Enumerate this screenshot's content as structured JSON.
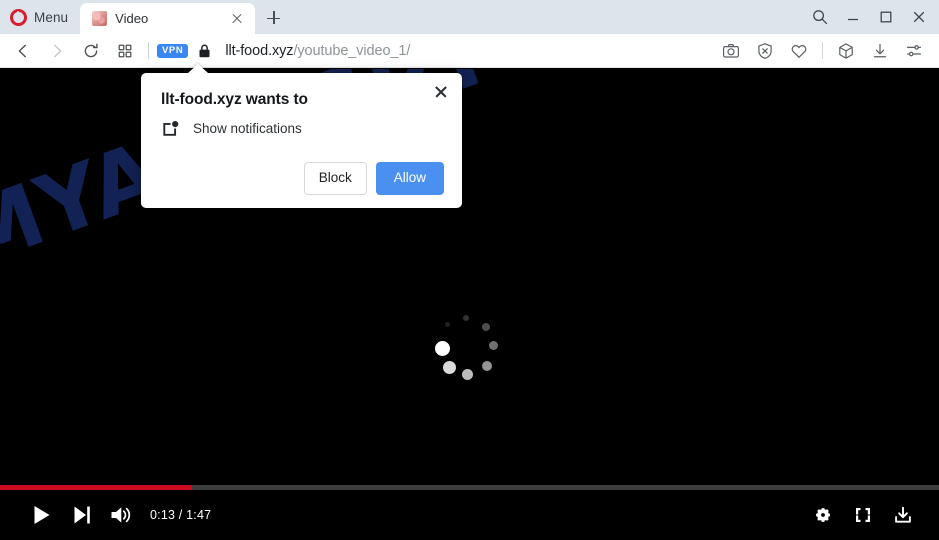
{
  "window": {
    "menu_label": "Menu",
    "controls": [
      {
        "name": "search",
        "icon": "search-icon"
      },
      {
        "name": "minimize",
        "icon": "minimize-icon"
      },
      {
        "name": "maximize",
        "icon": "maximize-icon"
      },
      {
        "name": "close",
        "icon": "close-icon"
      }
    ]
  },
  "tabs": [
    {
      "title": "Video",
      "favicon": "video-favicon",
      "active": true
    }
  ],
  "newtab_tooltip": "New tab",
  "toolbar": {
    "back": "back-arrow-icon",
    "forward": "forward-arrow-icon",
    "reload": "reload-icon",
    "workspaces": "grid-icon",
    "vpn_label": "VPN",
    "lock": "padlock-icon",
    "url_domain": "llt-food.xyz",
    "url_path": "/youtube_video_1/",
    "url_full": "llt-food.xyz/youtube_video_1/",
    "right_icons": [
      {
        "name": "snapshot-icon"
      },
      {
        "name": "ad-blocker-shield-icon"
      },
      {
        "name": "heart-icon"
      },
      {
        "name": "extensions-cube-icon"
      },
      {
        "name": "downloads-icon"
      },
      {
        "name": "easy-setup-sliders-icon"
      }
    ]
  },
  "permission_dialog": {
    "title": "llt-food.xyz wants to",
    "reason": "Show notifications",
    "icon": "notification-popup-icon",
    "block_label": "Block",
    "allow_label": "Allow",
    "close_label": "Close",
    "allow_color": "#4a90f0"
  },
  "page": {
    "watermark": "MYANTISPYWARE.COM",
    "watermark_color": "#15255c",
    "background_color": "#000000",
    "loading_spinner": "loading-spinner"
  },
  "player": {
    "progress_percent": 20.5,
    "progress_color": "#cc0a1f",
    "track_color": "#3d3d3d",
    "current_time": "0:13",
    "duration": "1:47",
    "time_display": "0:13 / 1:47",
    "play_label": "Play",
    "next_label": "Next video",
    "volume_label": "Mute",
    "settings_label": "Settings",
    "fullscreen_label": "Full screen",
    "download_label": "Download"
  }
}
